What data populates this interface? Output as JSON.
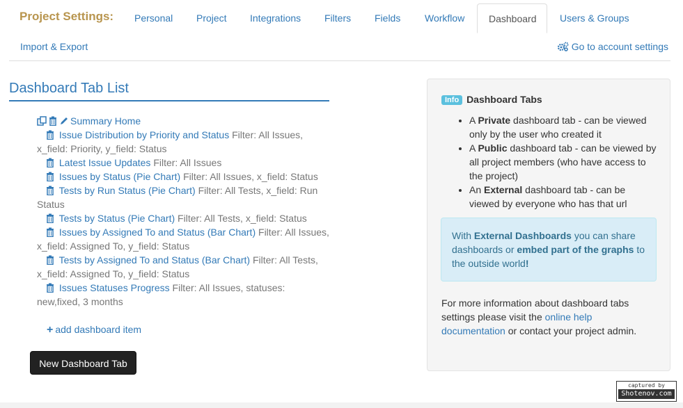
{
  "nav": {
    "brand": "Project Settings:",
    "tabs": [
      "Personal",
      "Project",
      "Integrations",
      "Filters",
      "Fields",
      "Workflow",
      "Dashboard",
      "Users & Groups"
    ],
    "active_tab": "Dashboard",
    "row2": "Import & Export",
    "account_link": "Go to account settings"
  },
  "list": {
    "title": "Dashboard Tab List",
    "root": "Summary Home",
    "items": [
      {
        "name": "Issue Distribution by Priority and Status",
        "filter": "Filter: All Issues, x_field: Priority, y_field: Status"
      },
      {
        "name": "Latest Issue Updates",
        "filter": "Filter: All Issues"
      },
      {
        "name": "Issues by Status (Pie Chart)",
        "filter": "Filter: All Issues, x_field: Status"
      },
      {
        "name": "Tests by Run Status (Pie Chart)",
        "filter": "Filter: All Tests, x_field: Run Status"
      },
      {
        "name": "Tests by Status (Pie Chart)",
        "filter": "Filter: All Tests, x_field: Status"
      },
      {
        "name": "Issues by Assigned To and Status (Bar Chart)",
        "filter": "Filter: All Issues, x_field: Assigned To, y_field: Status"
      },
      {
        "name": "Tests by Assigned To and Status (Bar Chart)",
        "filter": "Filter: All Tests, x_field: Assigned To, y_field: Status"
      },
      {
        "name": "Issues Statuses Progress",
        "filter": "Filter: All Issues, statuses: new,fixed, 3 months"
      }
    ],
    "add_item": "add dashboard item",
    "new_tab_button": "New Dashboard Tab"
  },
  "panel": {
    "badge": "Info",
    "heading": "Dashboard Tabs",
    "bullets": [
      {
        "prefix": "A ",
        "bold": "Private",
        "rest": " dashboard tab - can be viewed only by the user who created it"
      },
      {
        "prefix": "A ",
        "bold": "Public",
        "rest": " dashboard tab - can be viewed by all project members (who have access to the project)"
      },
      {
        "prefix": "An ",
        "bold": "External",
        "rest": " dashboard tab - can be viewed by everyone who has that url"
      }
    ],
    "alert": {
      "t1": "With ",
      "b1": "External Dashboards",
      "t2": " you can share dashboards or ",
      "b2": "embed part of the graphs",
      "t3": " to the outside world",
      "b3": "!"
    },
    "footer": {
      "t1": "For more information about dashboard tabs settings please visit the ",
      "link": "online help documentation",
      "t2": " or contact your project admin."
    }
  },
  "watermark": {
    "line1": "captured by",
    "line2": "Shotenov.com"
  }
}
